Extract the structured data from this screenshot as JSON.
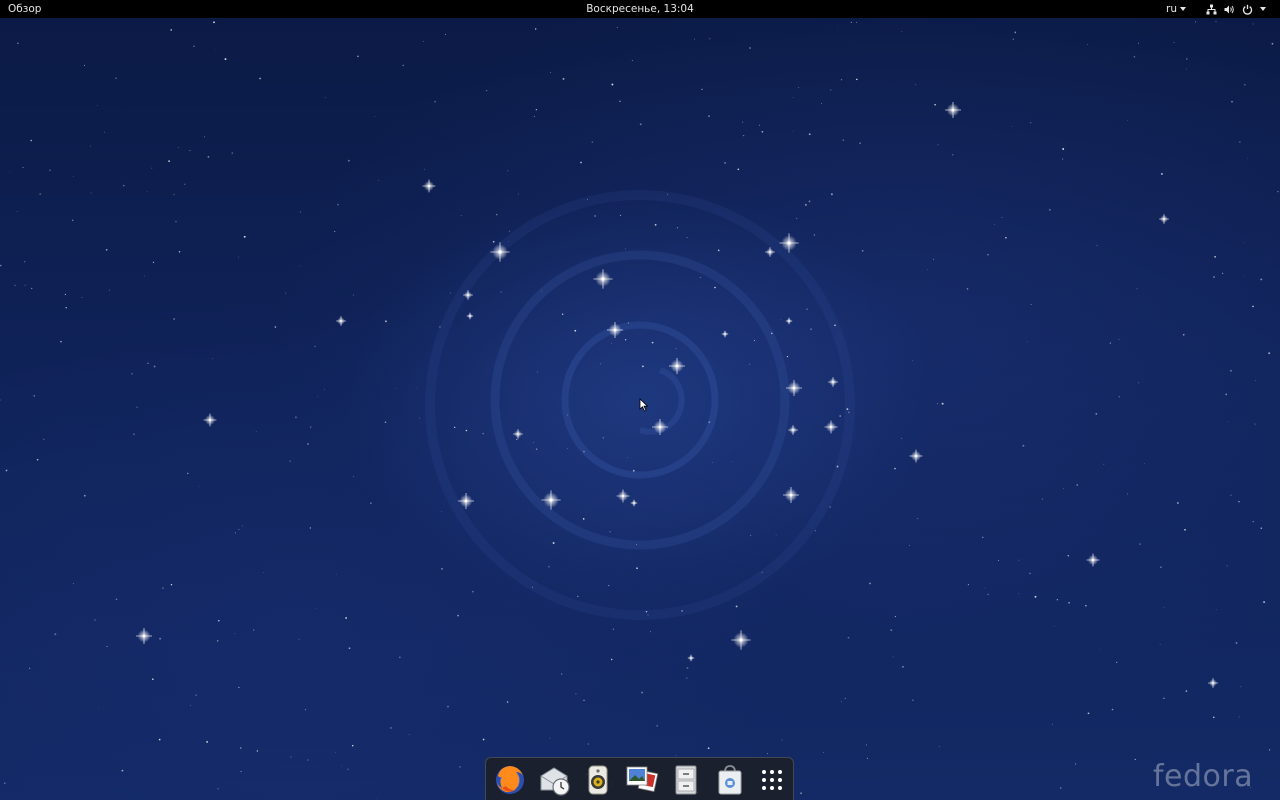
{
  "top_bar": {
    "activities_label": "Обзор",
    "clock": "Воскресенье, 13:04",
    "keyboard_layout": "ru",
    "status_icons": [
      "network-icon",
      "volume-icon",
      "power-icon",
      "chevron-down-icon"
    ]
  },
  "dash": {
    "items": [
      {
        "name": "firefox",
        "icon": "firefox-icon"
      },
      {
        "name": "evolution",
        "icon": "evolution-mail-clock-icon"
      },
      {
        "name": "rhythmbox",
        "icon": "speaker-icon"
      },
      {
        "name": "shotwell",
        "icon": "photos-icon"
      },
      {
        "name": "files",
        "icon": "file-cabinet-icon"
      },
      {
        "name": "software",
        "icon": "shopping-bag-icon"
      },
      {
        "name": "show-applications",
        "icon": "app-grid-icon"
      }
    ]
  },
  "desktop": {
    "watermark": "fedora"
  },
  "colors": {
    "top_bar_bg": "#000000",
    "wallpaper_dark": "#0b1a45",
    "wallpaper_mid": "#132a66",
    "dash_bg": "#1c1e24"
  }
}
